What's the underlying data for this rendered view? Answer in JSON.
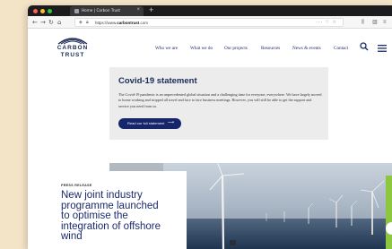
{
  "browser": {
    "tab_title": "Home | Carbon Trust",
    "tab_close": "×",
    "new_tab": "+",
    "url_prefix": "https://www.",
    "url_domain": "carbontrust",
    "url_suffix": ".com",
    "url_actions": "··· ♡ ☆",
    "colors": {
      "close": "#fe5f57",
      "minimize": "#febc2e",
      "maximize": "#28c840"
    }
  },
  "site": {
    "logo": {
      "line1": "CARBON",
      "line2": "TRUST"
    },
    "nav": [
      "Who we are",
      "What we do",
      "Our projects",
      "Resources",
      "News & events",
      "Contact"
    ]
  },
  "covid": {
    "title": "Covid-19 statement",
    "body": "The Covid-19 pandemic is an unprecedented global situation and a challenging time for everyone, everywhere. We have largely moved to home working and stopped all travel and face to face business meetings. However, you will still be able to get the support and service you need from us.",
    "button": "Read our full statement",
    "button_arrow": "⟶"
  },
  "press": {
    "label": "PRESS RELEASE",
    "headline_lines": [
      "New joint industry",
      "programme launched",
      "to optimise the",
      "integration of offshore",
      "wind"
    ]
  },
  "colors": {
    "brand_navy": "#16266b",
    "accent_green": "#8dc63f",
    "panel_grey": "#ececec",
    "page_bg": "#f3e3c7"
  }
}
